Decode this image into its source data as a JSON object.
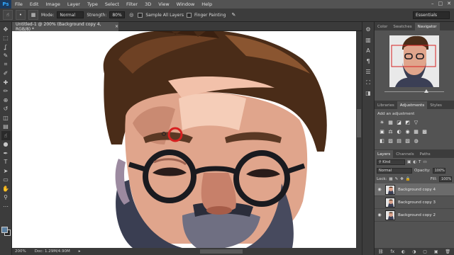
{
  "app": {
    "logo": "Ps"
  },
  "menu": [
    "File",
    "Edit",
    "Image",
    "Layer",
    "Type",
    "Select",
    "Filter",
    "3D",
    "View",
    "Window",
    "Help"
  ],
  "window_controls": [
    "–",
    "□",
    "✕"
  ],
  "options": {
    "mode_label": "Mode:",
    "mode_value": "Normal",
    "strength_label": "Strength:",
    "strength_value": "80%",
    "sample_all_layers": "Sample All Layers",
    "finger_painting": "Finger Painting",
    "workspace": "Essentials"
  },
  "document": {
    "tab_title": "Untitled-1 @ 200% (Background copy 4, RGB/8) *",
    "close_glyph": "×"
  },
  "status": {
    "zoom": "200%",
    "doc_info": "Doc: 1.29M/4.90M"
  },
  "panels": {
    "top_tabs": [
      "Color",
      "Swatches",
      "Navigator"
    ],
    "mid_tabs": [
      "Libraries",
      "Adjustments",
      "Styles"
    ],
    "adjustments_hint": "Add an adjustment",
    "layer_tabs": [
      "Layers",
      "Channels",
      "Paths"
    ],
    "kind_label": "Kind",
    "blend_mode": "Normal",
    "opacity_label": "Opacity:",
    "opacity_value": "100%",
    "lock_label": "Lock:",
    "fill_label": "Fill:",
    "fill_value": "100%",
    "layers": [
      {
        "name": "Background copy 4",
        "active": true
      },
      {
        "name": "Background copy 3",
        "active": false
      },
      {
        "name": "Background copy 2",
        "active": false
      }
    ]
  },
  "icons": {
    "tools": [
      "move-icon",
      "marquee-icon",
      "lasso-icon",
      "quick-select-icon",
      "crop-icon",
      "eyedropper-icon",
      "healing-brush-icon",
      "brush-icon",
      "clone-stamp-icon",
      "history-brush-icon",
      "eraser-icon",
      "gradient-icon",
      "smudge-icon",
      "dodge-icon",
      "pen-icon",
      "type-icon",
      "path-select-icon",
      "rectangle-icon",
      "hand-icon",
      "zoom-icon"
    ],
    "tool_glyphs": [
      "✥",
      "⬚",
      "ʆ",
      "✎",
      "⌗",
      "✐",
      "✚",
      "✏",
      "⊕",
      "↺",
      "◫",
      "▤",
      "☝",
      "●",
      "✒",
      "T",
      "➤",
      "▭",
      "✋",
      "⚲"
    ],
    "side_glyphs": [
      "⚙",
      "▥",
      "A",
      "¶",
      "☰",
      "⛶",
      "◨"
    ],
    "adj_row1": [
      "☀",
      "▦",
      "◪",
      "◩",
      "▽"
    ],
    "adj_row2": [
      "▣",
      "⚖",
      "◐",
      "◉",
      "▦",
      "▩"
    ],
    "adj_row3": [
      "◧",
      "▨",
      "▤",
      "▧",
      "◍"
    ],
    "layer_footer": [
      "⛓",
      "fx",
      "◐",
      "◑",
      "▢",
      "▣",
      "🗑"
    ]
  },
  "colors": {
    "foreground": "#5a7fa0",
    "background": "#262626",
    "selection_ring": "#d62020"
  }
}
